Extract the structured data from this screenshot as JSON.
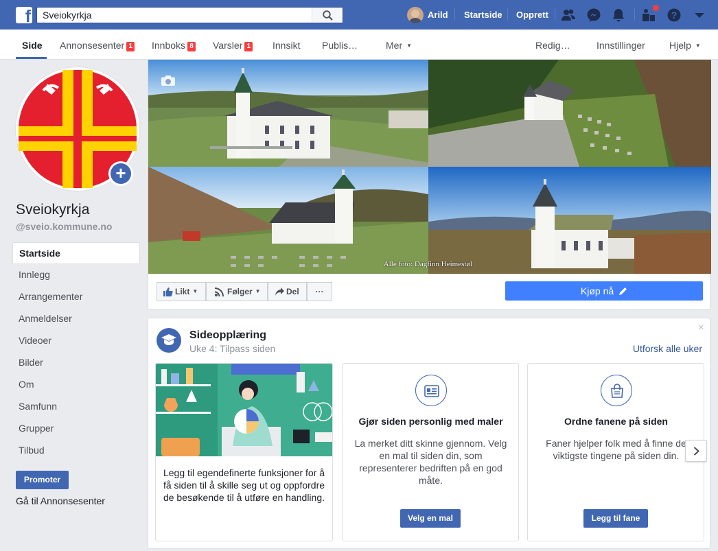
{
  "topbar": {
    "search_value": "Sveiokyrkja",
    "user_name": "Arild",
    "home_link": "Startside",
    "create_link": "Opprett",
    "bar_color": "#4267b2",
    "icons": [
      "friend-requests-icon",
      "messenger-icon",
      "notifications-icon",
      "page-manager-icon",
      "help-icon",
      "account-menu-caret-icon"
    ]
  },
  "tabs": {
    "page": "Side",
    "ads_center": "Annonsesenter",
    "ads_center_badge": "1",
    "inbox": "Innboks",
    "inbox_badge": "8",
    "notifications": "Varsler",
    "notifications_badge": "1",
    "insights": "Innsikt",
    "publishing": "Publis…",
    "more": "Mer",
    "edit": "Redig…",
    "settings": "Innstillinger",
    "help": "Hjelp"
  },
  "page": {
    "name": "Sveiokyrkja",
    "handle": "@sveio.kommune.no"
  },
  "side_nav": [
    "Startside",
    "Innlegg",
    "Arrangementer",
    "Anmeldelser",
    "Videoer",
    "Bilder",
    "Om",
    "Samfunn",
    "Grupper",
    "Tilbud"
  ],
  "promote_label": "Promoter",
  "ads_center_link": "Gå til Annonsesenter",
  "cover": {
    "photo_credit": "Alle foto: Dagfinn Heimestøl"
  },
  "actions": {
    "like": "Likt",
    "follow": "Følger",
    "share": "Del",
    "more": "···",
    "buy": "Kjøp nå"
  },
  "onboarding": {
    "title": "Sideopplæring",
    "subtitle": "Uke 4: Tilpass siden",
    "explore": "Utforsk alle uker",
    "close": "×",
    "tiles": [
      {
        "text": "Legg til egendefinerte funksjoner for å få siden til å skille seg ut og oppfordre de besøkende til å utføre en handling."
      },
      {
        "title": "Gjør siden personlig med maler",
        "desc": "La merket ditt skinne gjennom. Velg en mal til siden din, som representerer bedriften på en god måte.",
        "button": "Velg en mal"
      },
      {
        "title": "Ordne fanene på siden",
        "desc": "Faner hjelper folk med å finne de viktigste tingene på siden din.",
        "button": "Legg til fane"
      }
    ]
  }
}
